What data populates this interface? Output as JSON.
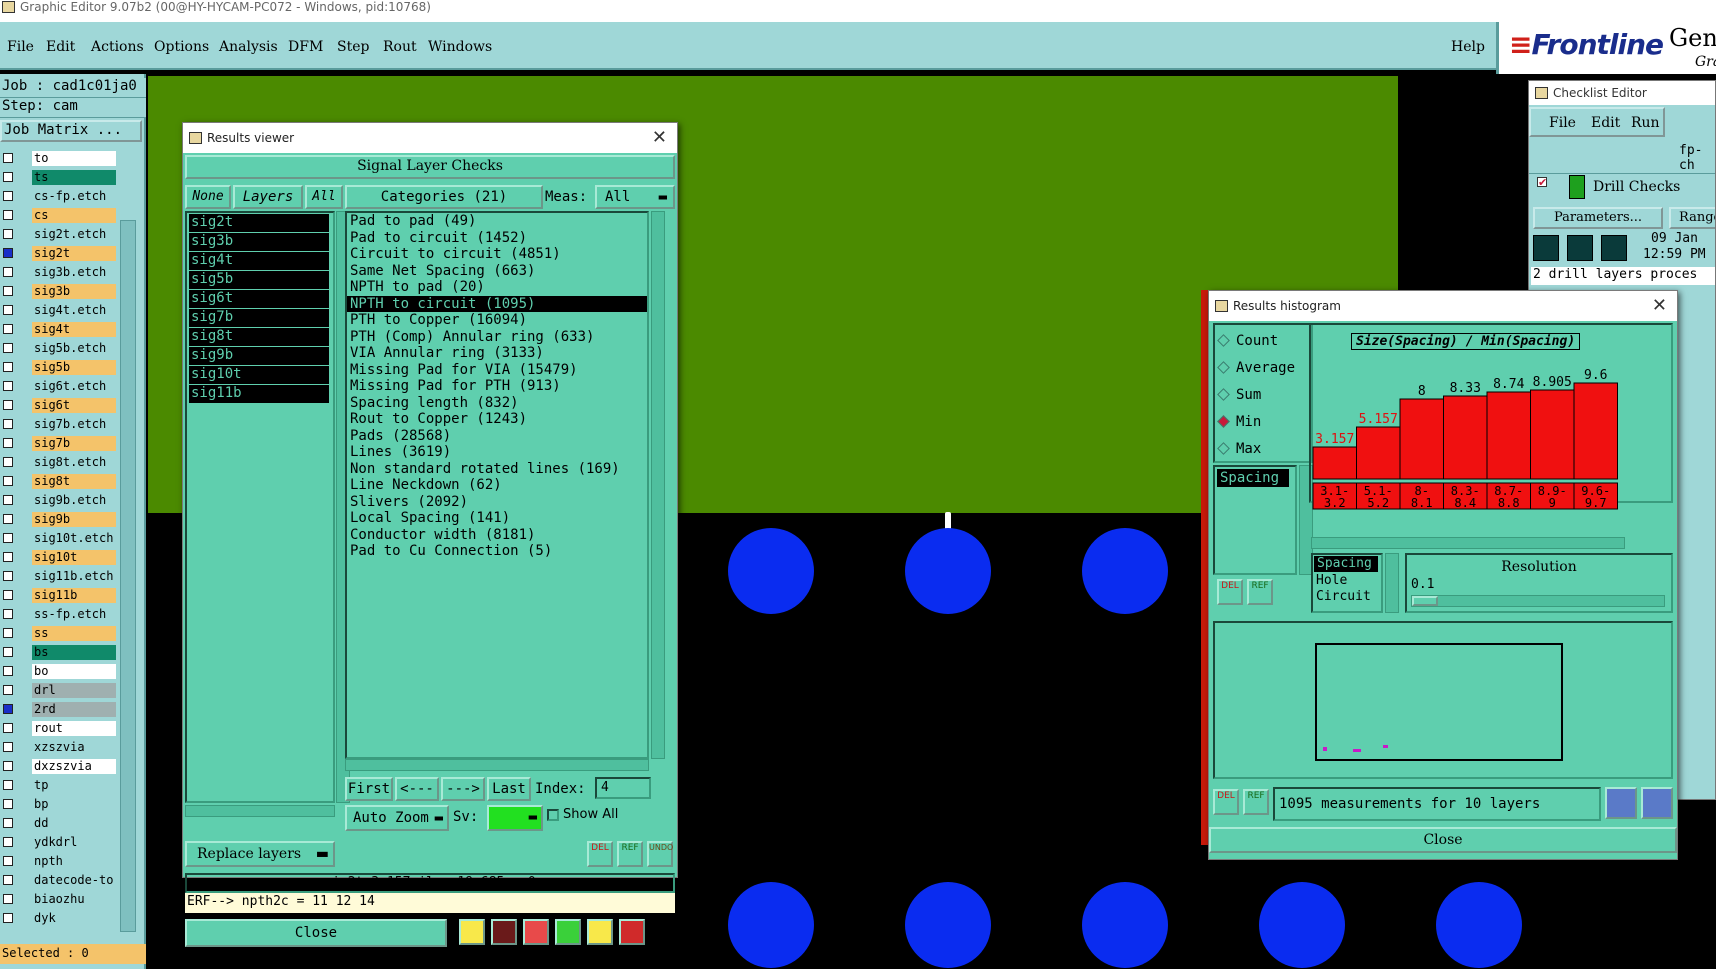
{
  "window": {
    "title": "Graphic Editor 9.07b2 (00@HY-HYCAM-PC072 - Windows, pid:10768)"
  },
  "menu": [
    "File",
    "Edit",
    "Actions",
    "Options",
    "Analysis",
    "DFM",
    "Step",
    "Rout",
    "Windows"
  ],
  "help": "Help",
  "logo": {
    "brand": "Frontline",
    "suffix": "Gene",
    "sub": "Gra"
  },
  "left": {
    "job": "Job : cad1c01ja0",
    "step": "Step: cam",
    "job_matrix": "Job Matrix ...",
    "layers": [
      {
        "name": "to",
        "color": "#ffffff",
        "on": false
      },
      {
        "name": "ts",
        "color": "#108a6a",
        "on": false
      },
      {
        "name": "cs-fp.etch",
        "color": "#9fd7d7",
        "on": false
      },
      {
        "name": "cs",
        "color": "#f4c36a",
        "on": false
      },
      {
        "name": "sig2t.etch",
        "color": "#9fd7d7",
        "on": false
      },
      {
        "name": "sig2t",
        "color": "#f4c36a",
        "on": true
      },
      {
        "name": "sig3b.etch",
        "color": "#9fd7d7",
        "on": false
      },
      {
        "name": "sig3b",
        "color": "#f4c36a",
        "on": false
      },
      {
        "name": "sig4t.etch",
        "color": "#9fd7d7",
        "on": false
      },
      {
        "name": "sig4t",
        "color": "#f4c36a",
        "on": false
      },
      {
        "name": "sig5b.etch",
        "color": "#9fd7d7",
        "on": false
      },
      {
        "name": "sig5b",
        "color": "#f4c36a",
        "on": false
      },
      {
        "name": "sig6t.etch",
        "color": "#9fd7d7",
        "on": false
      },
      {
        "name": "sig6t",
        "color": "#f4c36a",
        "on": false
      },
      {
        "name": "sig7b.etch",
        "color": "#9fd7d7",
        "on": false
      },
      {
        "name": "sig7b",
        "color": "#f4c36a",
        "on": false
      },
      {
        "name": "sig8t.etch",
        "color": "#9fd7d7",
        "on": false
      },
      {
        "name": "sig8t",
        "color": "#f4c36a",
        "on": false
      },
      {
        "name": "sig9b.etch",
        "color": "#9fd7d7",
        "on": false
      },
      {
        "name": "sig9b",
        "color": "#f4c36a",
        "on": false
      },
      {
        "name": "sig10t.etch",
        "color": "#9fd7d7",
        "on": false
      },
      {
        "name": "sig10t",
        "color": "#f4c36a",
        "on": false
      },
      {
        "name": "sig11b.etch",
        "color": "#9fd7d7",
        "on": false
      },
      {
        "name": "sig11b",
        "color": "#f4c36a",
        "on": false
      },
      {
        "name": "ss-fp.etch",
        "color": "#9fd7d7",
        "on": false
      },
      {
        "name": "ss",
        "color": "#f4c36a",
        "on": false
      },
      {
        "name": "bs",
        "color": "#108a6a",
        "on": false
      },
      {
        "name": "bo",
        "color": "#ffffff",
        "on": false
      },
      {
        "name": "drl",
        "color": "#9fb0b0",
        "on": false
      },
      {
        "name": "2rd",
        "color": "#9fb0b0",
        "on": true
      },
      {
        "name": "rout",
        "color": "#ffffff",
        "on": false
      },
      {
        "name": "xzszvia",
        "color": "#9fd7d7",
        "on": false
      },
      {
        "name": "dxzszvia",
        "color": "#ffffff",
        "on": false
      },
      {
        "name": "tp",
        "color": "#9fd7d7",
        "on": false
      },
      {
        "name": "bp",
        "color": "#9fd7d7",
        "on": false
      },
      {
        "name": "dd",
        "color": "#9fd7d7",
        "on": false
      },
      {
        "name": "ydkdrl",
        "color": "#9fd7d7",
        "on": false
      },
      {
        "name": "npth",
        "color": "#9fd7d7",
        "on": false
      },
      {
        "name": "datecode-to",
        "color": "#9fd7d7",
        "on": false
      },
      {
        "name": "biaozhu",
        "color": "#9fd7d7",
        "on": false
      },
      {
        "name": "dyk",
        "color": "#9fd7d7",
        "on": false
      }
    ],
    "selected": "Selected : 0"
  },
  "results_viewer": {
    "title": "Results viewer",
    "header": "Signal Layer Checks",
    "none": "None",
    "layers_label": "Layers",
    "all": "All",
    "categories_label": "Categories (21)",
    "meas_label": "Meas:",
    "meas_value": "All",
    "layers": [
      "sig2t",
      "sig3b",
      "sig4t",
      "sig5b",
      "sig6t",
      "sig7b",
      "sig8t",
      "sig9b",
      "sig10t",
      "sig11b"
    ],
    "categories": [
      "Pad to pad (49)",
      "Pad to circuit (1452)",
      "Circuit to circuit (4851)",
      "Same Net Spacing (663)",
      "NPTH to pad (20)",
      "NPTH to circuit (1095)",
      "PTH to Copper (16094)",
      "PTH (Comp) Annular ring (633)",
      "VIA Annular ring (3133)",
      "Missing Pad for VIA (15479)",
      "Missing Pad for PTH (913)",
      "Spacing length (832)",
      "Rout to Copper (1243)",
      "Pads (28568)",
      "Lines (3619)",
      "Non standard rotated lines (169)",
      "Line Neckdown (62)",
      "Slivers (2092)",
      "Local Spacing (141)",
      "Conductor width (8181)",
      "Pad to Cu Connection (5)"
    ],
    "selected_category": 5,
    "first": "First",
    "prev": "<---",
    "next": "--->",
    "last": "Last",
    "index_label": "Index:",
    "index_value": "4",
    "auto_zoom": "Auto Zoom",
    "sv_label": "Sv:",
    "show_all": "Show All",
    "replace_layers": "Replace layers",
    "status": "sig2t 3.157mil  r19.685  r0",
    "erf": "ERF--> npth2c = 11 12 14",
    "close": "Close",
    "del": "DEL",
    "ref": "REF",
    "undo": "UNDO"
  },
  "checklist": {
    "title": "Checklist Editor",
    "menu": [
      "File",
      "Edit",
      "Run"
    ],
    "name": "fp-ch",
    "drill_checks": "Drill Checks",
    "parameters": "Parameters...",
    "range": "Range",
    "date": "09 Jan",
    "time": "12:59 PM",
    "status": "2 drill layers proces"
  },
  "histogram": {
    "title": "Results histogram",
    "modes": [
      "Count",
      "Average",
      "Sum",
      "Min",
      "Max"
    ],
    "selected_mode": "Min",
    "measure_list": [
      "Spacing"
    ],
    "chart_title": "Size(Spacing) / Min(Spacing)",
    "bars": [
      {
        "label": "3.157",
        "range": "3.1-\n3.2",
        "value": 3.157,
        "red_label": true
      },
      {
        "label": "5.157",
        "range": "5.1-\n5.2",
        "value": 5.157,
        "red_label": true
      },
      {
        "label": "8",
        "range": "8-\n8.1",
        "value": 8,
        "red_label": false
      },
      {
        "label": "8.33",
        "range": "8.3-\n8.4",
        "value": 8.33,
        "red_label": false
      },
      {
        "label": "8.74",
        "range": "8.7-\n8.8",
        "value": 8.74,
        "red_label": false
      },
      {
        "label": "8.905",
        "range": "8.9-\n9",
        "value": 8.905,
        "red_label": false
      },
      {
        "label": "9.6",
        "range": "9.6-\n9.7",
        "value": 9.6,
        "red_label": false
      }
    ],
    "res_options": [
      "Spacing",
      "Hole",
      "Circuit"
    ],
    "resolution_label": "Resolution",
    "resolution_value": "0.1",
    "summary": "1095 measurements for 10 layers",
    "close": "Close",
    "del": "DEL",
    "ref": "REF"
  },
  "colors": {
    "panel": "#9fd7d7",
    "dialog": "#5fcfae",
    "board_green": "#4b8a00",
    "pad_blue": "#0a2cf0",
    "bar_red": "#f01010"
  }
}
